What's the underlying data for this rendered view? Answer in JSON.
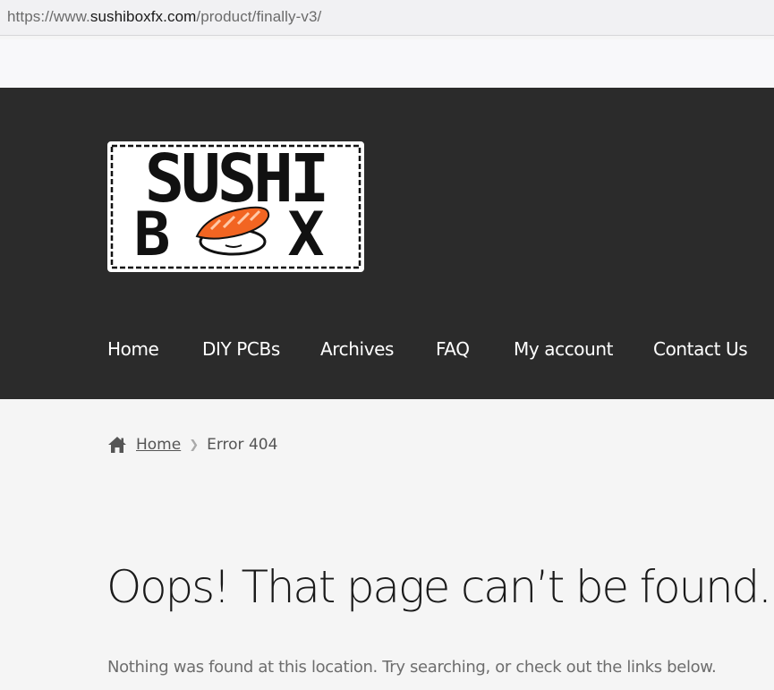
{
  "browser": {
    "url_scheme": "https://www.",
    "url_host": "sushiboxfx.com",
    "url_path": "/product/finally-v3/"
  },
  "logo": {
    "line1": "SUSHI",
    "line2_left": "B",
    "line2_right": "X"
  },
  "nav": {
    "items": [
      {
        "label": "Home"
      },
      {
        "label": "DIY PCBs"
      },
      {
        "label": "Archives"
      },
      {
        "label": "FAQ"
      },
      {
        "label": "My account"
      },
      {
        "label": "Contact Us"
      }
    ]
  },
  "breadcrumb": {
    "home_label": "Home",
    "current_label": "Error 404"
  },
  "content": {
    "title": "Oops! That page can’t be found.",
    "message": "Nothing was found at this location. Try searching, or check out the links below."
  },
  "colors": {
    "header_bg": "#2b2b2b",
    "page_bg": "#f5f5f5",
    "sushi_orange": "#f26522"
  }
}
